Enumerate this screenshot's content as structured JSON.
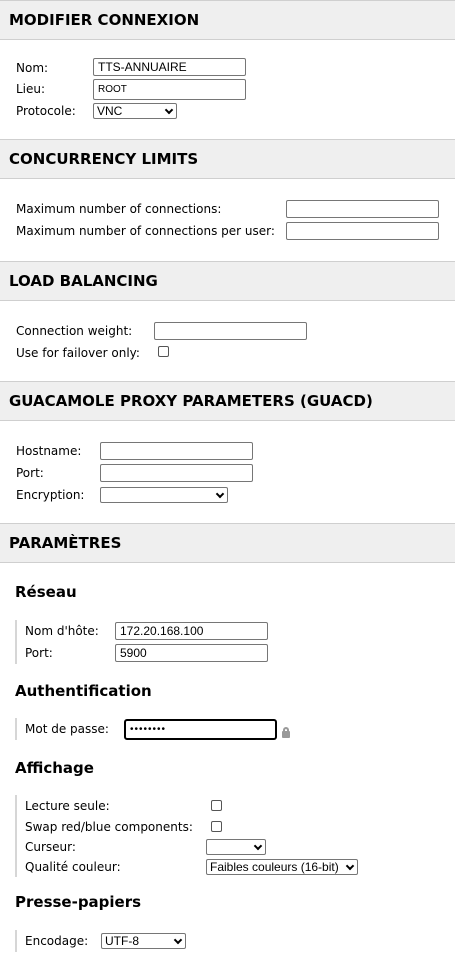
{
  "sections": {
    "edit_connection": "MODIFIER CONNEXION",
    "concurrency": "CONCURRENCY LIMITS",
    "load_balancing": "LOAD BALANCING",
    "guacd": "GUACAMOLE PROXY PARAMETERS (GUACD)",
    "parameters": "PARAMÈTRES"
  },
  "connection": {
    "name_label": "Nom:",
    "name_value": "TTS-ANNUAIRE",
    "location_label": "Lieu:",
    "location_value": "ROOT",
    "protocol_label": "Protocole:",
    "protocol_value": "VNC"
  },
  "concurrency": {
    "max_connections_label": "Maximum number of connections:",
    "max_connections_value": "",
    "max_per_user_label": "Maximum number of connections per user:",
    "max_per_user_value": ""
  },
  "load_balancing": {
    "weight_label": "Connection weight:",
    "weight_value": "",
    "failover_label": "Use for failover only:",
    "failover_checked": false
  },
  "guacd": {
    "hostname_label": "Hostname:",
    "hostname_value": "",
    "port_label": "Port:",
    "port_value": "",
    "encryption_label": "Encryption:",
    "encryption_value": ""
  },
  "parameters": {
    "network": {
      "title": "Réseau",
      "hostname_label": "Nom d'hôte:",
      "hostname_value": "172.20.168.100",
      "port_label": "Port:",
      "port_value": "5900"
    },
    "auth": {
      "title": "Authentification",
      "password_label": "Mot de passe:",
      "password_mask": "••••••••"
    },
    "display": {
      "title": "Affichage",
      "readonly_label": "Lecture seule:",
      "swap_label": "Swap red/blue components:",
      "cursor_label": "Curseur:",
      "cursor_value": "",
      "color_label": "Qualité couleur:",
      "color_value": "Faibles couleurs (16-bit)"
    },
    "clipboard": {
      "title": "Presse-papiers",
      "encoding_label": "Encodage:",
      "encoding_value": "UTF-8"
    }
  },
  "colors": {
    "header_bg": "#efefef",
    "field_border": "#767676",
    "focus_border": "#000000"
  },
  "icons": {
    "password_toggle": "lock-icon"
  }
}
